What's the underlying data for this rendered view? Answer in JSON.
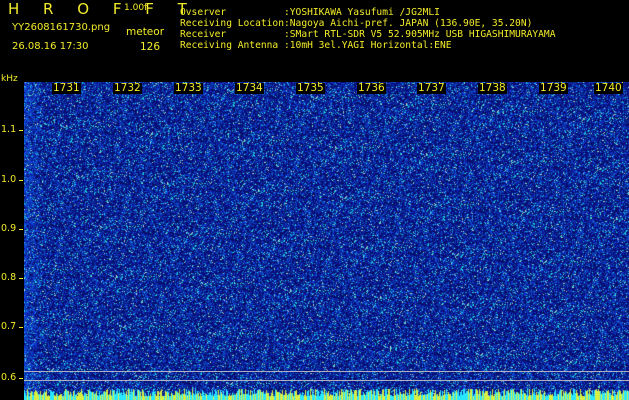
{
  "header": {
    "app_title": "H R O F F T",
    "version": "1.00f",
    "filename": "YY2608161730.png",
    "mode": "meteor",
    "datetime": "26.08.16 17:30",
    "count": "126"
  },
  "info": [
    {
      "key": "Ovserver",
      "value": ":YOSHIKAWA Yasufumi /JG2MLI"
    },
    {
      "key": "Receiving Location",
      "value": ":Nagoya Aichi-pref. JAPAN (136.90E, 35.20N)"
    },
    {
      "key": "Receiver",
      "value": ":SMart RTL-SDR V5 52.905MHz USB HIGASHIMURAYAMA"
    },
    {
      "key": "Receiving Antenna",
      "value": ":10mH 3el.YAGI Horizontal:ENE"
    }
  ],
  "axis": {
    "y_unit": "kHz",
    "y_ticks": [
      "1.1",
      "1.0",
      "0.9",
      "0.8",
      "0.7",
      "0.6"
    ],
    "time_ticks": [
      "1731",
      "1732",
      "1733",
      "1734",
      "1735",
      "1736",
      "1737",
      "1738",
      "1739",
      "1740"
    ]
  },
  "colors": {
    "text": "#f2ec2a",
    "background": "#000000",
    "spectrum_base": "#0c1a8c",
    "noise_bright": "#2fd6f0",
    "floor": "#28e8ff"
  }
}
